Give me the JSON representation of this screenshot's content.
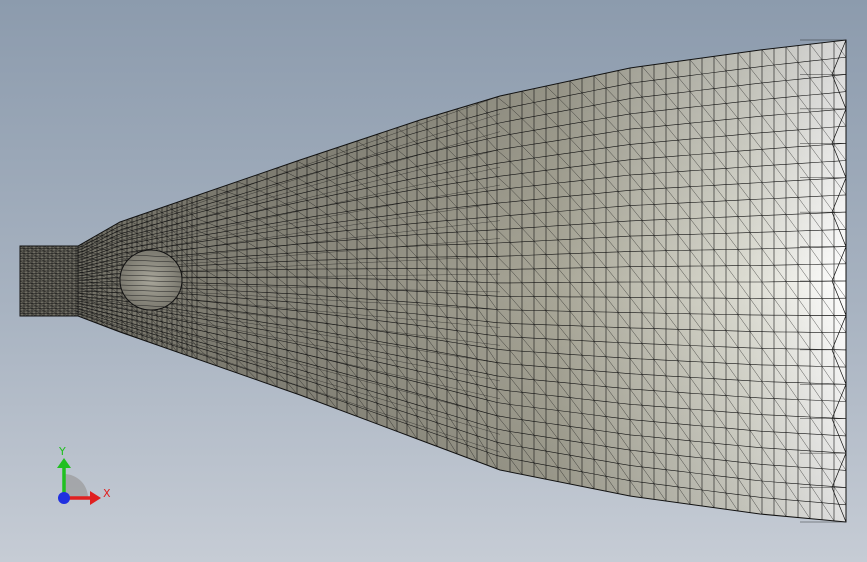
{
  "viewport": {
    "background_top": "#8c9bad",
    "background_bottom": "#c6ccd5",
    "mesh_stroke": "#111111",
    "mesh_fill_dark": "#7d7b70",
    "mesh_fill_light": "#f6f6f1"
  },
  "triad": {
    "x_label": "X",
    "y_label": "Y",
    "x_color": "#e02020",
    "y_color": "#20c020",
    "z_color": "#2030e0"
  }
}
